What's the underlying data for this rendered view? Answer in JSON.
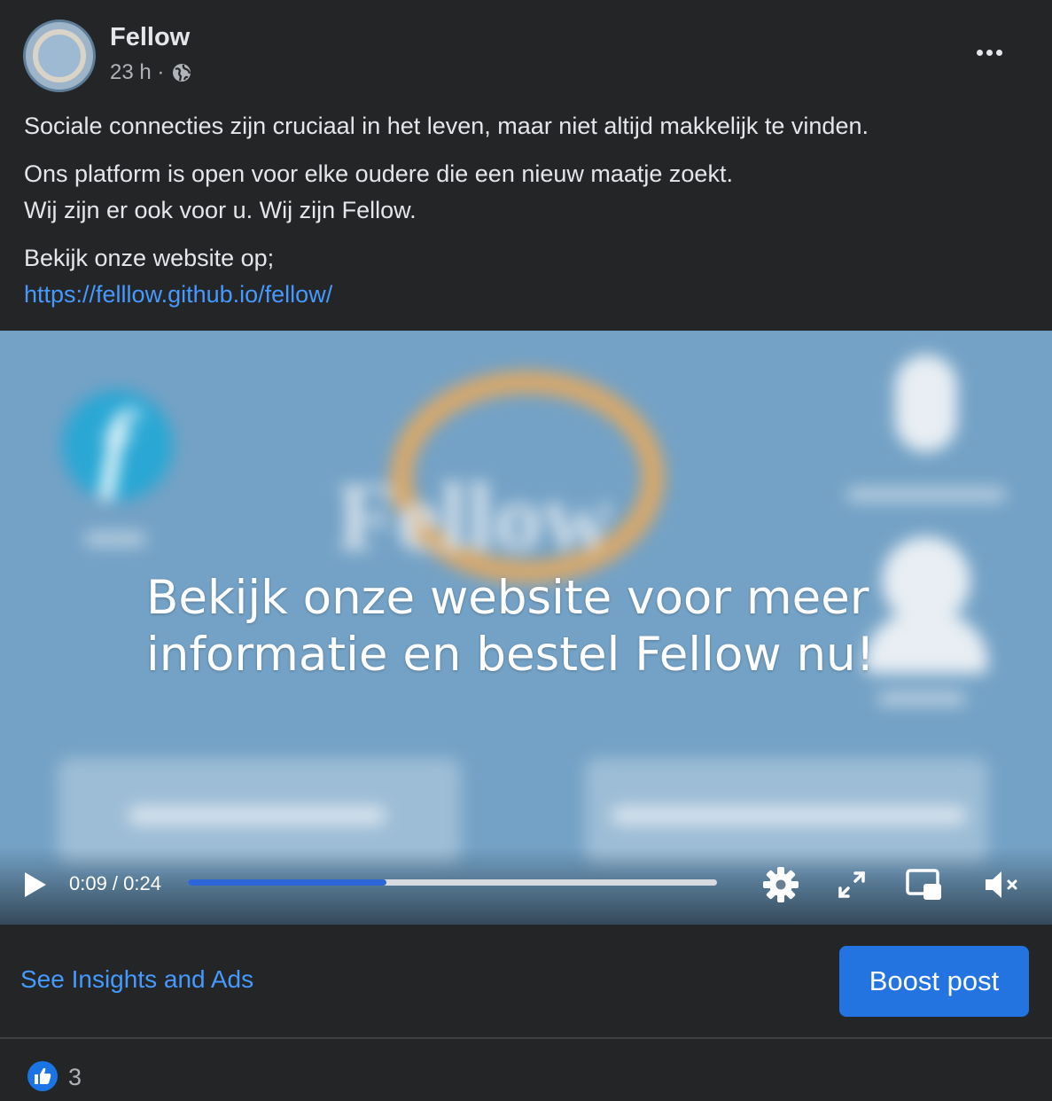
{
  "post": {
    "page_name": "Fellow",
    "time": "23 h ·",
    "paragraphs": [
      "Sociale connecties zijn cruciaal in het leven, maar niet altijd makkelijk te vinden.",
      "Ons platform is open voor elke oudere die een nieuw maatje zoekt.",
      "Wij zijn er ook voor u. Wij zijn Fellow.",
      "Bekijk onze website op;"
    ],
    "link": "https://felllow.github.io/fellow/"
  },
  "video": {
    "overlay_line1": "Bekijk onze website voor meer",
    "overlay_line2": "informatie en bestel Fellow nu!",
    "blurred_wordmark": "Fellow",
    "current_time": "0:09",
    "duration": "0:24",
    "time_display": "0:09 / 0:24",
    "progress_fraction": 0.375
  },
  "actions": {
    "insights_label": "See Insights and Ads",
    "boost_label": "Boost post"
  },
  "reactions": {
    "count": "3"
  },
  "icons": {
    "header": [
      "globe-icon",
      "more-options-icon"
    ],
    "video": [
      "play-icon",
      "settings-icon",
      "fullscreen-icon",
      "picture-in-picture-icon",
      "muted-volume-icon"
    ],
    "reactions": [
      "like-reaction-icon"
    ]
  },
  "colors": {
    "background": "#242526",
    "link": "#4599ff",
    "boost_button": "#2374e1",
    "progress_fill": "#2d67d7",
    "video_background": "#74a2c6"
  }
}
